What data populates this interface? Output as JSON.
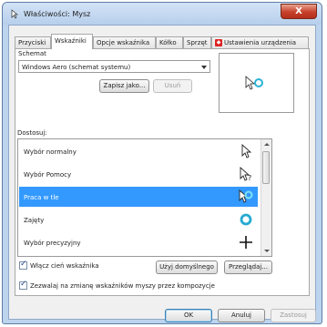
{
  "window": {
    "title": "Właściwości: Mysz",
    "close_label": "X"
  },
  "tabs": [
    {
      "label": "Przyciski"
    },
    {
      "label": "Wskaźniki"
    },
    {
      "label": "Opcje wskaźnika"
    },
    {
      "label": "Kółko"
    },
    {
      "label": "Sprzęt"
    },
    {
      "label": "Ustawienia urządzenia"
    }
  ],
  "scheme": {
    "label": "Schemat",
    "value": "Windows Aero (schemat systemu)",
    "save_as_label": "Zapisz jako...",
    "delete_label": "Usuń"
  },
  "customize": {
    "label": "Dostosuj:",
    "rows": [
      {
        "label": "Wybór normalny",
        "icon": "arrow-cursor-icon"
      },
      {
        "label": "Wybór Pomocy",
        "icon": "help-cursor-icon"
      },
      {
        "label": "Praca w tle",
        "icon": "working-in-background-cursor-icon",
        "selected": true
      },
      {
        "label": "Zajęty",
        "icon": "busy-cursor-icon"
      },
      {
        "label": "Wybór precyzyjny",
        "icon": "precision-cursor-icon"
      }
    ]
  },
  "options": {
    "shadow_label": "Włącz cień wskaźnika",
    "default_button": "Użyj domyślnego",
    "browse_button": "Przeglądaj...",
    "themes_label": "Zezwalaj na zmianę wskaźników myszy przez kompozycje"
  },
  "footer": {
    "ok": "OK",
    "cancel": "Anuluj",
    "apply": "Zastosuj"
  },
  "colors": {
    "selection": "#3399ff",
    "title_bar": "#bcd4ee",
    "close_button": "#c7402b"
  }
}
